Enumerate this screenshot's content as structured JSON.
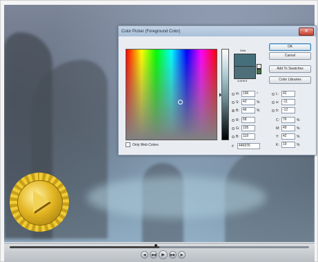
{
  "dialog": {
    "title": "Color Picker (Foreground Color)",
    "close_glyph": "✕",
    "new_label": "new",
    "current_label": "current",
    "buttons": {
      "ok": "OK",
      "cancel": "Cancel",
      "add_to_swatches": "Add To Swatches",
      "color_libraries": "Color Libraries"
    },
    "fields": {
      "H": {
        "label": "H:",
        "value": "196",
        "unit": "°"
      },
      "S": {
        "label": "S:",
        "value": "42",
        "unit": "%"
      },
      "B": {
        "label": "B:",
        "value": "46",
        "unit": "%"
      },
      "R": {
        "label": "R:",
        "value": "68",
        "unit": ""
      },
      "G": {
        "label": "G:",
        "value": "105",
        "unit": ""
      },
      "Bl": {
        "label": "B:",
        "value": "118",
        "unit": ""
      },
      "L": {
        "label": "L:",
        "value": "42",
        "unit": ""
      },
      "a": {
        "label": "a:",
        "value": "-11",
        "unit": ""
      },
      "b": {
        "label": "b:",
        "value": "-12",
        "unit": ""
      },
      "C": {
        "label": "C:",
        "value": "76",
        "unit": "%"
      },
      "M": {
        "label": "M:",
        "value": "49",
        "unit": "%"
      },
      "Y": {
        "label": "Y:",
        "value": "42",
        "unit": "%"
      },
      "K": {
        "label": "K:",
        "value": "19",
        "unit": "%"
      }
    },
    "hex": {
      "label": "#",
      "value": "446976"
    },
    "only_web_colors": "Only Web Colors",
    "new_color": "#45707b",
    "current_color": "#4e6f7a"
  },
  "player": {
    "progress": 0.5,
    "controls": {
      "prev": "◀",
      "rewind": "◀◀",
      "play": "▶",
      "forward": "▶▶",
      "next": "▶"
    }
  },
  "badge": {
    "icon": "play-icon"
  }
}
